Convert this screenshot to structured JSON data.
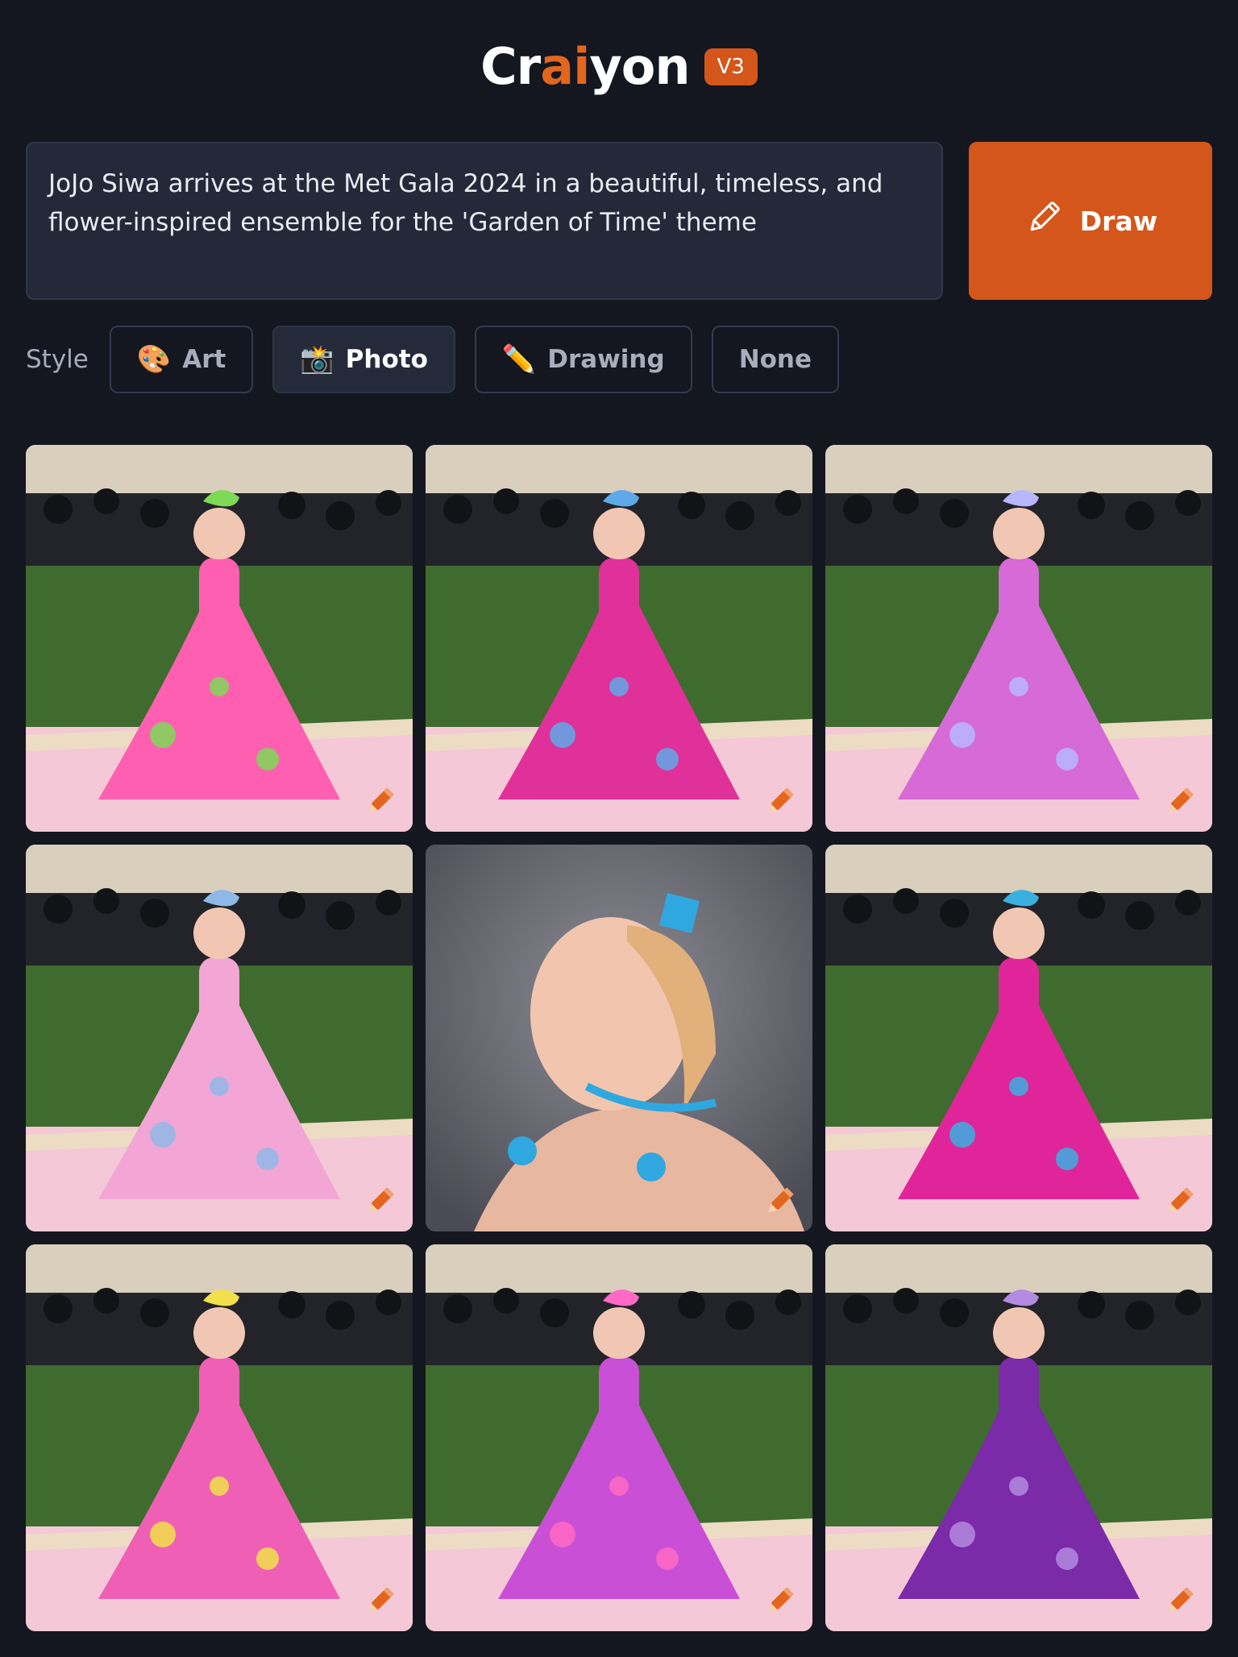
{
  "header": {
    "logo_pre": "Cr",
    "logo_ai": "ai",
    "logo_post": "yon",
    "version": "V3"
  },
  "prompt": {
    "text": "JoJo Siwa arrives at the Met Gala 2024 in a beautiful, timeless, and flower-inspired ensemble for the 'Garden of Time' theme"
  },
  "draw_button": {
    "label": "Draw",
    "icon": "pencil-icon"
  },
  "style": {
    "label": "Style",
    "options": [
      {
        "label": "Art",
        "icon": "palette-icon",
        "active": false
      },
      {
        "label": "Photo",
        "icon": "camera-flash-icon",
        "active": true
      },
      {
        "label": "Drawing",
        "icon": "pencil-icon",
        "active": false
      },
      {
        "label": "None",
        "icon": "",
        "active": false
      }
    ]
  },
  "results": {
    "count": 9,
    "items": [
      {
        "backdrop": "met-gala-carpet",
        "dress": "#ff5fb0",
        "accent": "#7ed957"
      },
      {
        "backdrop": "met-gala-carpet",
        "dress": "#e0309a",
        "accent": "#5fa9e8"
      },
      {
        "backdrop": "met-gala-carpet",
        "dress": "#d66ad6",
        "accent": "#b7b7ff"
      },
      {
        "backdrop": "met-gala-carpet",
        "dress": "#f3a6d6",
        "accent": "#8fb9e6"
      },
      {
        "backdrop": "studio-gray",
        "dress": "#e8b7a0",
        "accent": "#2fa8e0"
      },
      {
        "backdrop": "met-gala-carpet",
        "dress": "#e0259a",
        "accent": "#3ab0e0"
      },
      {
        "backdrop": "met-gala-carpet",
        "dress": "#f05fb6",
        "accent": "#f1e04a"
      },
      {
        "backdrop": "met-gala-carpet",
        "dress": "#c94fd6",
        "accent": "#ff69c4"
      },
      {
        "backdrop": "met-gala-carpet",
        "dress": "#7b2aa8",
        "accent": "#b38be0"
      }
    ],
    "colors": {
      "accent": "#d4561a",
      "background": "#141620",
      "panel": "#242839"
    }
  }
}
